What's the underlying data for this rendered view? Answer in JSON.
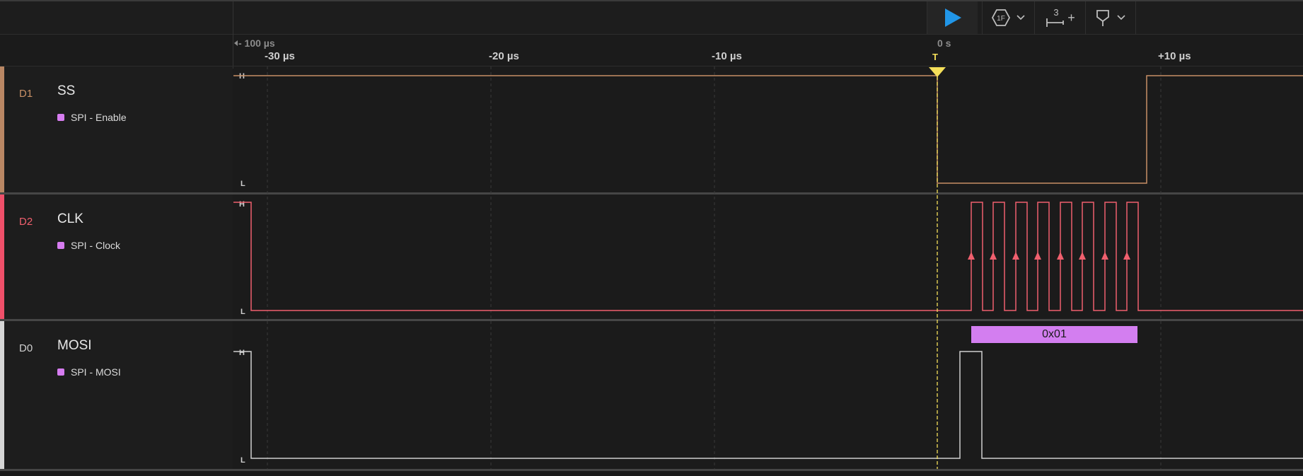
{
  "toolbar": {
    "run_icon": "play-icon",
    "trigger_icon": "trigger-settings-icon",
    "trigger_icon_text": "1F",
    "measure_icon": "measure-icon",
    "measure_count": "3",
    "measure_plus": "+",
    "marker_icon": "marker-icon",
    "dropdown_icon": "chevron-down-icon"
  },
  "timeline": {
    "offset_label": "- 100 µs",
    "zero_label": "0 s",
    "trigger_label": "T",
    "ticks": [
      "-30 µs",
      "-20 µs",
      "-10 µs",
      "+10 µs"
    ]
  },
  "channels": [
    {
      "id": "D1",
      "name": "SS",
      "analyzer": "SPI - Enable",
      "color": "#c89066"
    },
    {
      "id": "D2",
      "name": "CLK",
      "analyzer": "SPI - Clock",
      "color": "#f0606e"
    },
    {
      "id": "D0",
      "name": "MOSI",
      "analyzer": "SPI - MOSI",
      "color": "#cfcfcf"
    }
  ],
  "level_labels": {
    "high": "H",
    "low": "L"
  },
  "decode": {
    "value": "0x01",
    "color": "#d37ef0"
  },
  "colors": {
    "trigger": "#f5e05a",
    "run": "#2196e8",
    "background": "#1b1b1b"
  }
}
